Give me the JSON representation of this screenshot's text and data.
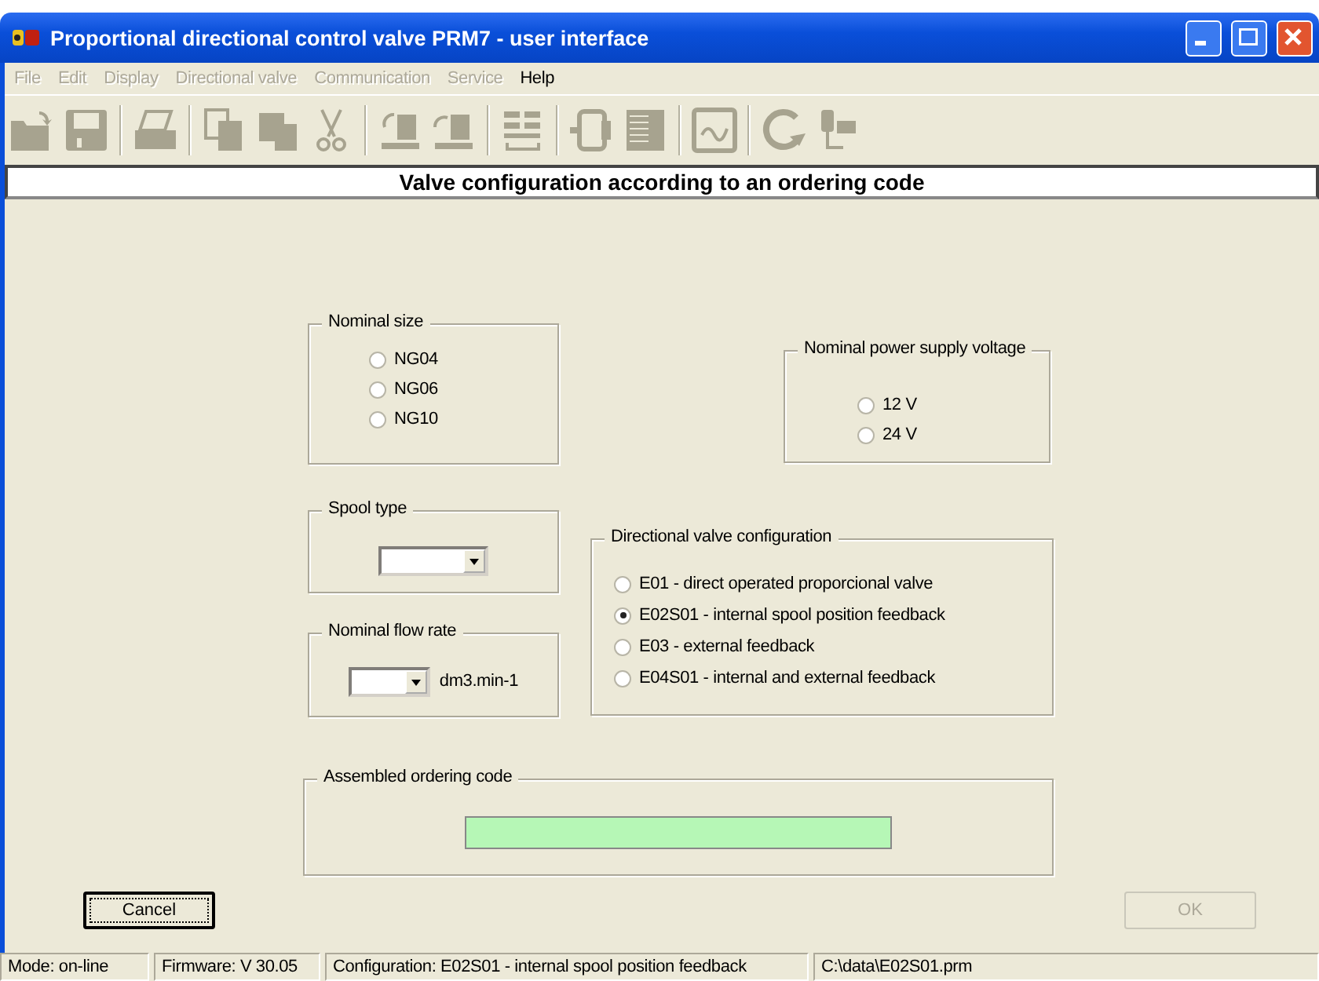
{
  "window": {
    "title": "Proportional directional control valve PRM7 - user interface"
  },
  "menu": [
    {
      "label": "File",
      "disabled": true
    },
    {
      "label": "Edit",
      "disabled": true
    },
    {
      "label": "Display",
      "disabled": true
    },
    {
      "label": "Directional valve",
      "disabled": true
    },
    {
      "label": "Communication",
      "disabled": true
    },
    {
      "label": "Service",
      "disabled": true
    },
    {
      "label": "Help",
      "disabled": false
    }
  ],
  "toolbar": [
    {
      "kind": "open",
      "disabled": true
    },
    {
      "kind": "save",
      "disabled": true
    },
    {
      "kind": "separator"
    },
    {
      "kind": "print",
      "disabled": true
    },
    {
      "kind": "separator"
    },
    {
      "kind": "copy",
      "disabled": true
    },
    {
      "kind": "paste",
      "disabled": true
    },
    {
      "kind": "cut",
      "disabled": true
    },
    {
      "kind": "separator"
    },
    {
      "kind": "upload",
      "disabled": true
    },
    {
      "kind": "download",
      "disabled": true
    },
    {
      "kind": "separator"
    },
    {
      "kind": "table",
      "disabled": true
    },
    {
      "kind": "separator"
    },
    {
      "kind": "network",
      "disabled": true
    },
    {
      "kind": "panel",
      "disabled": true
    },
    {
      "kind": "separator"
    },
    {
      "kind": "chart",
      "disabled": true
    },
    {
      "kind": "separator"
    },
    {
      "kind": "refresh",
      "disabled": true
    },
    {
      "kind": "transfer",
      "disabled": true
    }
  ],
  "heading": "Valve configuration according to an ordering code",
  "nominal_size": {
    "title": "Nominal size",
    "options": [
      {
        "label": "NG04",
        "selected": false
      },
      {
        "label": "NG06",
        "selected": false
      },
      {
        "label": "NG10",
        "selected": false
      }
    ]
  },
  "power_supply": {
    "title": "Nominal power supply voltage",
    "options": [
      {
        "label": "12 V",
        "selected": false
      },
      {
        "label": "24 V",
        "selected": false
      }
    ]
  },
  "spool_type": {
    "title": "Spool type"
  },
  "flow_rate": {
    "title": "Nominal flow rate",
    "unit": "dm3.min-1"
  },
  "configuration": {
    "title": "Directional valve configuration",
    "options": [
      {
        "label": "E01 - direct operated proporcional valve",
        "selected": false
      },
      {
        "label": "E02S01 - internal spool position feedback",
        "selected": true
      },
      {
        "label": "E03 - external feedback",
        "selected": false
      },
      {
        "label": "E04S01 - internal and external feedback",
        "selected": false
      }
    ]
  },
  "ordering_code": {
    "title": "Assembled ordering code"
  },
  "buttons": [
    {
      "label": "Cancel",
      "disabled": false,
      "focused": true
    },
    {
      "label": "OK",
      "disabled": true,
      "focused": false
    }
  ],
  "status_bar": [
    "Mode: on-line",
    "Firmware:  V 30.05",
    "Configuration: E02S01 - internal spool position feedback",
    "C:\\data\\E02S01.prm"
  ]
}
